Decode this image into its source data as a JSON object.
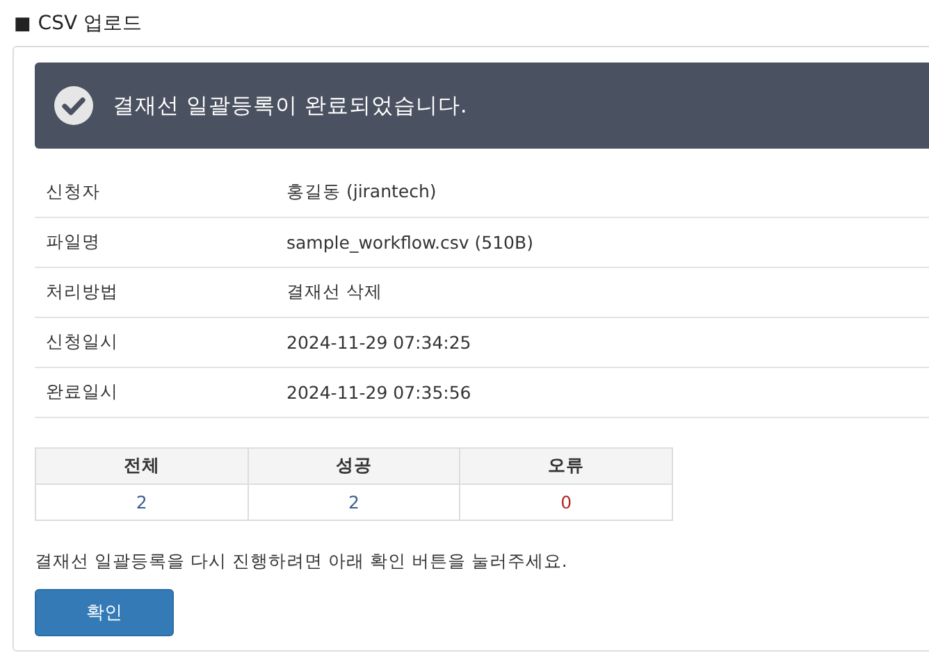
{
  "heading": {
    "mark": "■",
    "title": "CSV 업로드"
  },
  "banner": {
    "message": "결재선 일괄등록이 완료되었습니다."
  },
  "details": [
    {
      "label": "신청자",
      "value": "홍길동 (jirantech)"
    },
    {
      "label": "파일명",
      "value": "sample_workflow.csv (510B)"
    },
    {
      "label": "처리방법",
      "value": "결재선 삭제"
    },
    {
      "label": "신청일시",
      "value": "2024-11-29 07:34:25"
    },
    {
      "label": "완료일시",
      "value": "2024-11-29 07:35:56"
    }
  ],
  "stats": [
    {
      "label": "전체",
      "count": "2",
      "color": "#3d5f8f"
    },
    {
      "label": "성공",
      "count": "2",
      "color": "#3d5f8f"
    },
    {
      "label": "오류",
      "count": "0",
      "color": "#b02a2a"
    }
  ],
  "note": "결재선 일괄등록을 다시 진행하려면 아래 확인 버튼을 눌러주세요.",
  "confirm_button": "확인"
}
